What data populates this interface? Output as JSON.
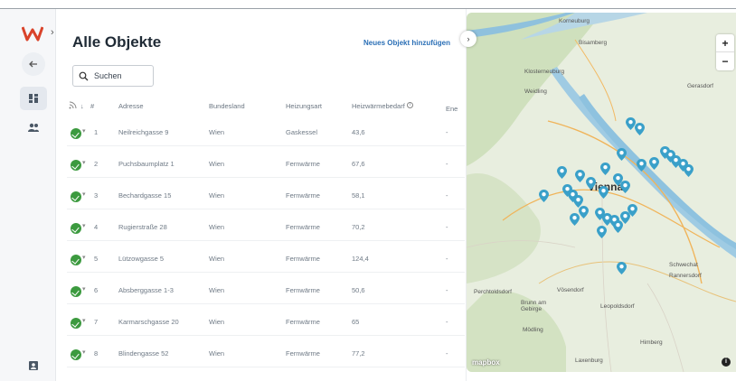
{
  "app": {
    "logo": "W"
  },
  "sidebar": {
    "back_icon": "arrow-left-icon",
    "items": [
      {
        "icon": "dashboard-icon",
        "active": true
      },
      {
        "icon": "people-icon",
        "active": false
      }
    ],
    "footer_icon": "account-icon"
  },
  "header": {
    "title": "Alle Objekte",
    "add_label": "Neues Objekt hinzufügen"
  },
  "search": {
    "placeholder": "Suchen"
  },
  "table": {
    "columns": [
      "#",
      "Adresse",
      "Bundesland",
      "Heizungsart",
      "Heizwärmebedarf",
      "Ene"
    ],
    "rows": [
      {
        "nr": "1",
        "adresse": "Neilreichgasse 9",
        "bundesland": "Wien",
        "heizung": "Gaskessel",
        "bedarf": "43,6",
        "extra": "-"
      },
      {
        "nr": "2",
        "adresse": "Puchsbaumplatz 1",
        "bundesland": "Wien",
        "heizung": "Fernwärme",
        "bedarf": "67,6",
        "extra": "-"
      },
      {
        "nr": "3",
        "adresse": "Bechardgasse 15",
        "bundesland": "Wien",
        "heizung": "Fernwärme",
        "bedarf": "58,1",
        "extra": "-"
      },
      {
        "nr": "4",
        "adresse": "Rugierstraße 28",
        "bundesland": "Wien",
        "heizung": "Fernwärme",
        "bedarf": "70,2",
        "extra": "-"
      },
      {
        "nr": "5",
        "adresse": "Lützowgasse 5",
        "bundesland": "Wien",
        "heizung": "Fernwärme",
        "bedarf": "124,4",
        "extra": "-"
      },
      {
        "nr": "6",
        "adresse": "Absberggasse 1-3",
        "bundesland": "Wien",
        "heizung": "Fernwärme",
        "bedarf": "50,6",
        "extra": "-"
      },
      {
        "nr": "7",
        "adresse": "Karmarschgasse 20",
        "bundesland": "Wien",
        "heizung": "Fernwärme",
        "bedarf": "65",
        "extra": "-"
      },
      {
        "nr": "8",
        "adresse": "Blindengasse 52",
        "bundesland": "Wien",
        "heizung": "Fernwärme",
        "bedarf": "77,2",
        "extra": "-"
      }
    ]
  },
  "map": {
    "labels": {
      "korneuburg": "Korneuburg",
      "bisamberg": "Bisamberg",
      "kloster": "Klosterneuburg",
      "weidling": "Weidling",
      "gerasdorf": "Gerasdorf",
      "city": "Vienna",
      "schwechat": "Schwechat",
      "rannersdorf": "Rannersdorf",
      "vosendorf": "Vösendorf",
      "leopoldsdorf": "Leopoldsdorf",
      "perchtoldsdorf": "Perchtoldsdorf",
      "brunn": "Brunn am Gebirge",
      "modling": "Mödling",
      "laxenburg": "Laxenburg",
      "himberg": "Himberg"
    },
    "attribution": "mapbox",
    "zoom_in": "+",
    "zoom_out": "−",
    "info": "i",
    "pin_color": "#3aa0c9"
  }
}
